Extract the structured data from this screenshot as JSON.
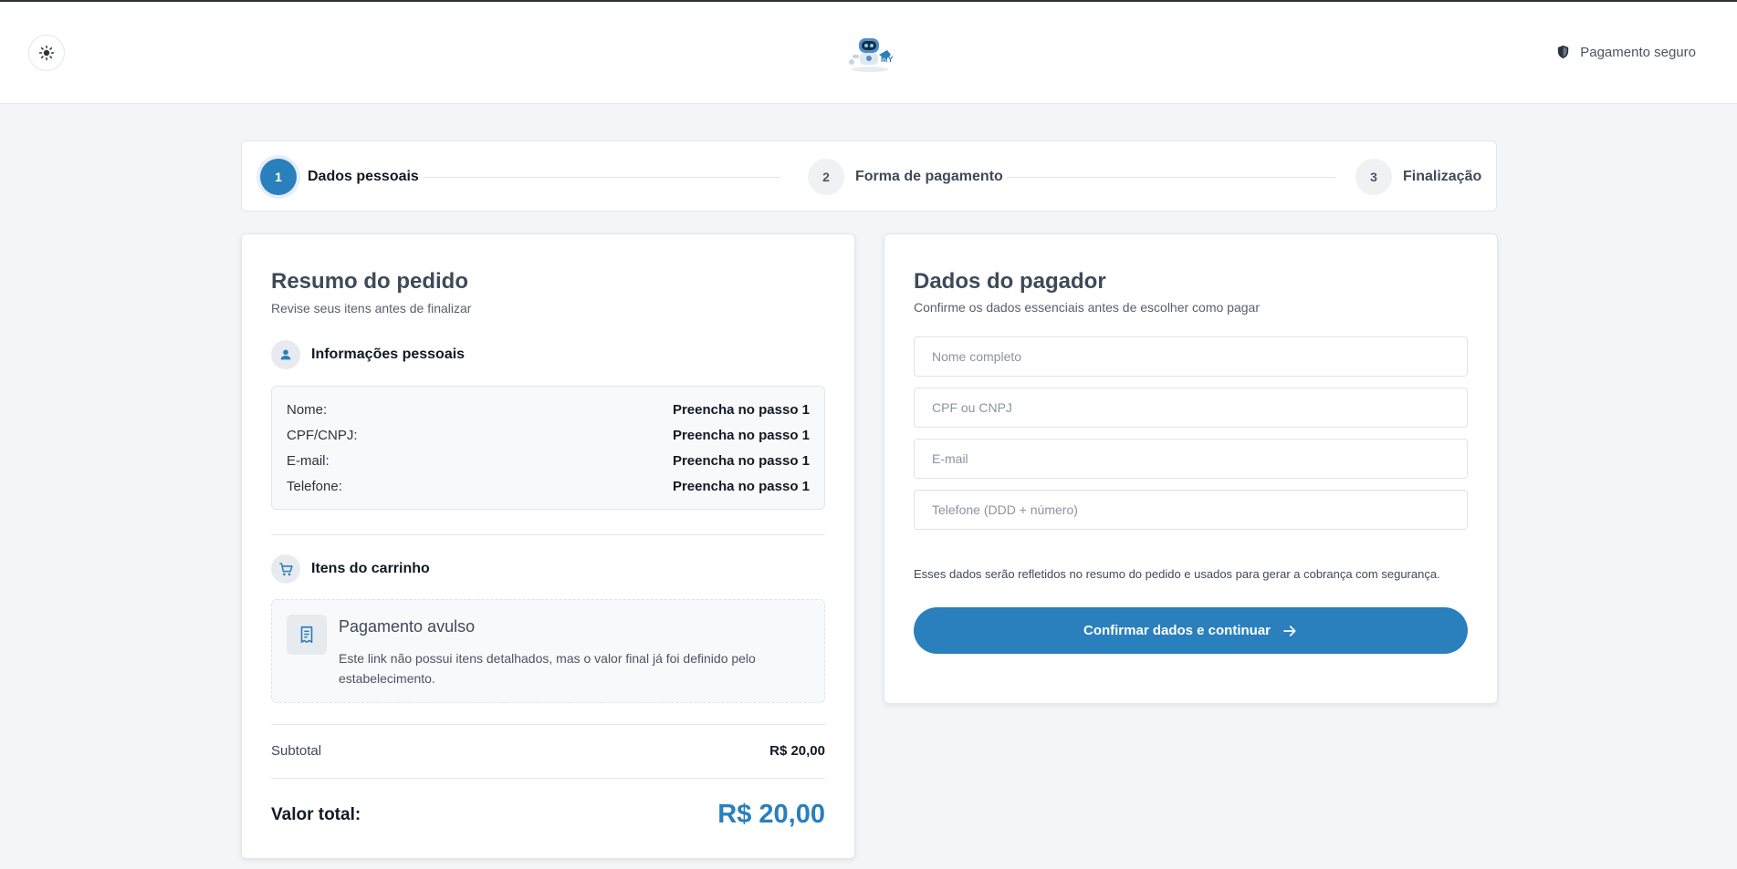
{
  "header": {
    "secure_label": "Pagamento seguro",
    "icons": {
      "theme": "sun-icon",
      "secure": "shield-icon",
      "logo": "robot-logo"
    }
  },
  "stepper": {
    "steps": [
      {
        "number": "1",
        "label": "Dados pessoais",
        "active": true
      },
      {
        "number": "2",
        "label": "Forma de pagamento",
        "active": false
      },
      {
        "number": "3",
        "label": "Finalização",
        "active": false
      }
    ]
  },
  "summary": {
    "title": "Resumo do pedido",
    "subtitle": "Revise seus itens antes de finalizar",
    "personal": {
      "title": "Informações pessoais",
      "icon": "person-icon",
      "rows": [
        {
          "key": "Nome:",
          "value": "Preencha no passo 1"
        },
        {
          "key": "CPF/CNPJ:",
          "value": "Preencha no passo 1"
        },
        {
          "key": "E-mail:",
          "value": "Preencha no passo 1"
        },
        {
          "key": "Telefone:",
          "value": "Preencha no passo 1"
        }
      ]
    },
    "cart": {
      "title": "Itens do carrinho",
      "icon": "cart-icon",
      "item": {
        "icon": "receipt-icon",
        "title": "Pagamento avulso",
        "description": "Este link não possui itens detalhados, mas o valor final já foi definido pelo estabelecimento."
      }
    },
    "subtotal_label": "Subtotal",
    "subtotal_value": "R$ 20,00",
    "total_label": "Valor total:",
    "total_value": "R$ 20,00"
  },
  "payer": {
    "title": "Dados do pagador",
    "subtitle": "Confirme os dados essenciais antes de escolher como pagar",
    "fields": {
      "name": {
        "placeholder": "Nome completo",
        "value": ""
      },
      "doc": {
        "placeholder": "CPF ou CNPJ",
        "value": ""
      },
      "email": {
        "placeholder": "E-mail",
        "value": ""
      },
      "phone": {
        "placeholder": "Telefone (DDD + número)",
        "value": ""
      }
    },
    "note": "Esses dados serão refletidos no resumo do pedido e usados para gerar a cobrança com segurança.",
    "confirm_label": "Confirmar dados e continuar",
    "confirm_icon": "arrow-right-icon"
  },
  "colors": {
    "accent": "#2a7fbd",
    "background": "#f4f5f7",
    "text": "#111a24"
  }
}
